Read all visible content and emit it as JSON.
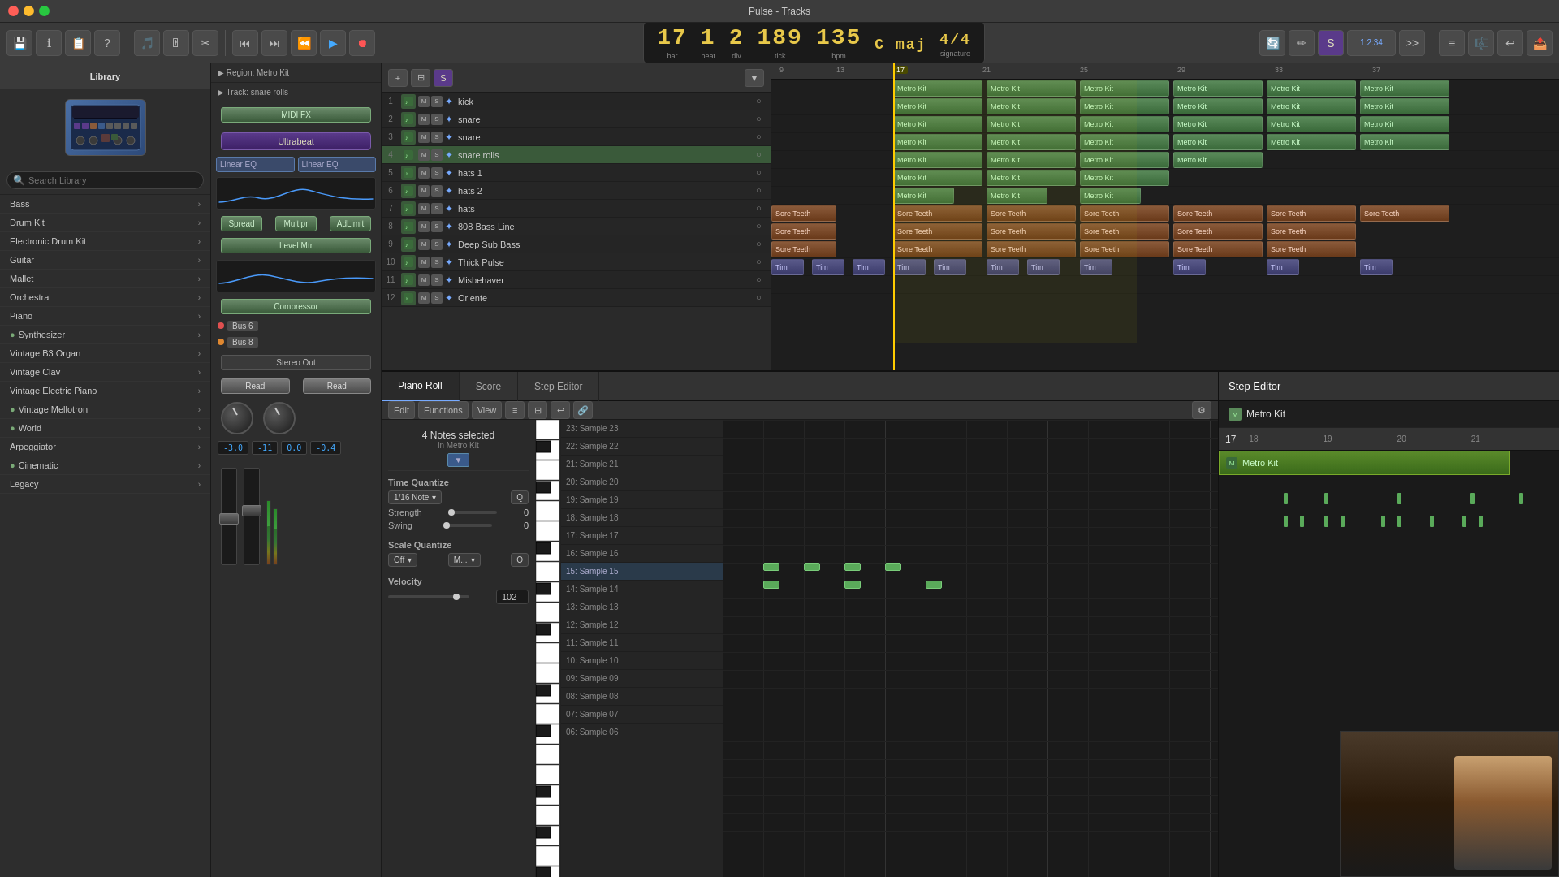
{
  "app": {
    "title": "Pulse - Tracks"
  },
  "titlebar": {
    "title": "Pulse - Tracks"
  },
  "transport": {
    "bar": "17",
    "beat": "1",
    "div": "2",
    "tick": "189",
    "bpm": "135",
    "key": "C maj",
    "signature": "4/4",
    "bar_label": "bar",
    "beat_label": "beat",
    "div_label": "div",
    "tick_label": "tick",
    "bpm_label": "bpm",
    "key_label": "",
    "sig_label": "signature"
  },
  "library": {
    "header": "Library",
    "search_placeholder": "Search Library",
    "items": [
      {
        "name": "Bass",
        "has_arrow": true,
        "has_circle": false
      },
      {
        "name": "Drum Kit",
        "has_arrow": true,
        "has_circle": false
      },
      {
        "name": "Electronic Drum Kit",
        "has_arrow": true,
        "has_circle": false
      },
      {
        "name": "Guitar",
        "has_arrow": true,
        "has_circle": false
      },
      {
        "name": "Mallet",
        "has_arrow": true,
        "has_circle": false
      },
      {
        "name": "Orchestral",
        "has_arrow": true,
        "has_circle": false
      },
      {
        "name": "Piano",
        "has_arrow": true,
        "has_circle": false
      },
      {
        "name": "Synthesizer",
        "has_arrow": true,
        "has_circle": true
      },
      {
        "name": "Vintage B3 Organ",
        "has_arrow": true,
        "has_circle": false
      },
      {
        "name": "Vintage Clav",
        "has_arrow": true,
        "has_circle": false
      },
      {
        "name": "Vintage Electric Piano",
        "has_arrow": true,
        "has_circle": false
      },
      {
        "name": "Vintage Mellotron",
        "has_arrow": true,
        "has_circle": true
      },
      {
        "name": "World",
        "has_arrow": true,
        "has_circle": true
      },
      {
        "name": "Arpeggiator",
        "has_arrow": true,
        "has_circle": false
      },
      {
        "name": "Cinematic",
        "has_arrow": true,
        "has_circle": true
      },
      {
        "name": "Legacy",
        "has_arrow": true,
        "has_circle": false
      }
    ]
  },
  "instrument": {
    "region_label": "▶ Region: Metro Kit",
    "track_label": "▶ Track:  snare rolls",
    "midi_fx": "MIDI FX",
    "ultrabeat": "Ultrabeat",
    "linear_eq_1": "Linear EQ",
    "linear_eq_2": "Linear EQ",
    "spread": "Spread",
    "multipr": "Multipr",
    "adlimit": "AdLimit",
    "level_mtr": "Level Mtr",
    "compressor": "Compressor",
    "bus6": "Bus 6",
    "bus8": "Bus 8",
    "stereo_out": "Stereo Out",
    "read1": "Read",
    "read2": "Read",
    "val1": "-3.0",
    "val2": "-11",
    "val3": "0.0",
    "val4": "-0.4"
  },
  "tracks": {
    "headers": [
      {
        "num": 1,
        "name": "kick"
      },
      {
        "num": 2,
        "name": "snare"
      },
      {
        "num": 3,
        "name": "snare"
      },
      {
        "num": 4,
        "name": "snare rolls"
      },
      {
        "num": 5,
        "name": "hats 1"
      },
      {
        "num": 6,
        "name": "hats 2"
      },
      {
        "num": 7,
        "name": "hats"
      },
      {
        "num": 8,
        "name": "808 Bass Line"
      },
      {
        "num": 9,
        "name": "Deep Sub Bass"
      },
      {
        "num": 10,
        "name": "Thick Pulse"
      },
      {
        "num": 11,
        "name": "Misbehaver"
      },
      {
        "num": 12,
        "name": "Oriente"
      }
    ],
    "ruler_marks": [
      "9",
      "13",
      "17",
      "21",
      "25",
      "29",
      "33",
      "37"
    ]
  },
  "piano_roll": {
    "tabs": [
      "Piano Roll",
      "Score",
      "Step Editor"
    ],
    "notes_selected": "4 Notes selected",
    "in_region": "in Metro Kit",
    "quantize": {
      "title": "Time Quantize",
      "note": "1/16 Note",
      "strength_label": "Strength",
      "strength_val": "0",
      "swing_label": "Swing",
      "swing_val": "0",
      "q_btn": "Q"
    },
    "scale_quantize": {
      "title": "Scale Quantize",
      "off": "Off",
      "mode": "M...",
      "q_btn": "Q"
    },
    "velocity": {
      "title": "Velocity",
      "val": "102"
    },
    "samples": [
      "23: Sample 23",
      "22: Sample 22",
      "21: Sample 21",
      "20: Sample 20",
      "19: Sample 19",
      "18: Sample 18",
      "17: Sample 17",
      "16: Sample 16",
      "15: Sample 15",
      "14: Sample 14",
      "13: Sample 13",
      "12: Sample 12",
      "11: Sample 11",
      "10: Sample 10",
      "09: Sample 09",
      "08: Sample 08",
      "07: Sample 07",
      "06: Sample 06"
    ]
  },
  "step_editor": {
    "tab_label": "Step Editor",
    "metro_kit_label": "Metro Kit"
  },
  "toolbar": {
    "edit": "Edit",
    "functions": "Functions",
    "view": "View",
    "functions2": "Functions",
    "view2": "View"
  }
}
